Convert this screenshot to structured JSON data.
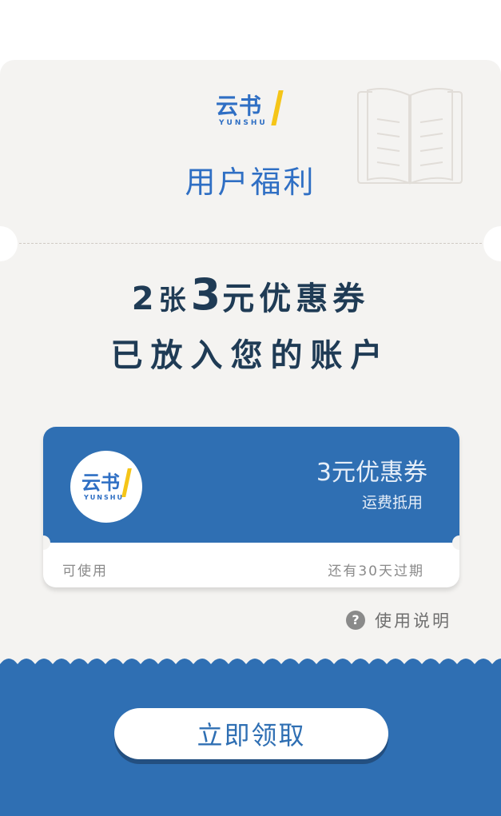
{
  "header": {
    "logo_text": "云书",
    "logo_sub": "YUNSHU",
    "title": "用户福利",
    "book_icon": "open-book-icon"
  },
  "headline": {
    "count": "2",
    "count_unit": "张",
    "amount": "3",
    "rest": "元优惠券",
    "line2": "已放入您的账户"
  },
  "coupon": {
    "logo_text": "云书",
    "logo_sub": "YUNSHU",
    "name": "3元优惠券",
    "desc": "运费抵用",
    "usable": "可使用",
    "expire": "还有30天过期"
  },
  "help": {
    "icon": "question-icon",
    "icon_glyph": "?",
    "label": "使用说明"
  },
  "claim_button": {
    "label": "立即领取"
  },
  "colors": {
    "brand_blue": "#2f6fb3",
    "logo_blue": "#2f6fc4",
    "accent_yellow": "#f5c518",
    "headline_text": "#1f3b55",
    "card_bg": "#f4f3f1"
  }
}
